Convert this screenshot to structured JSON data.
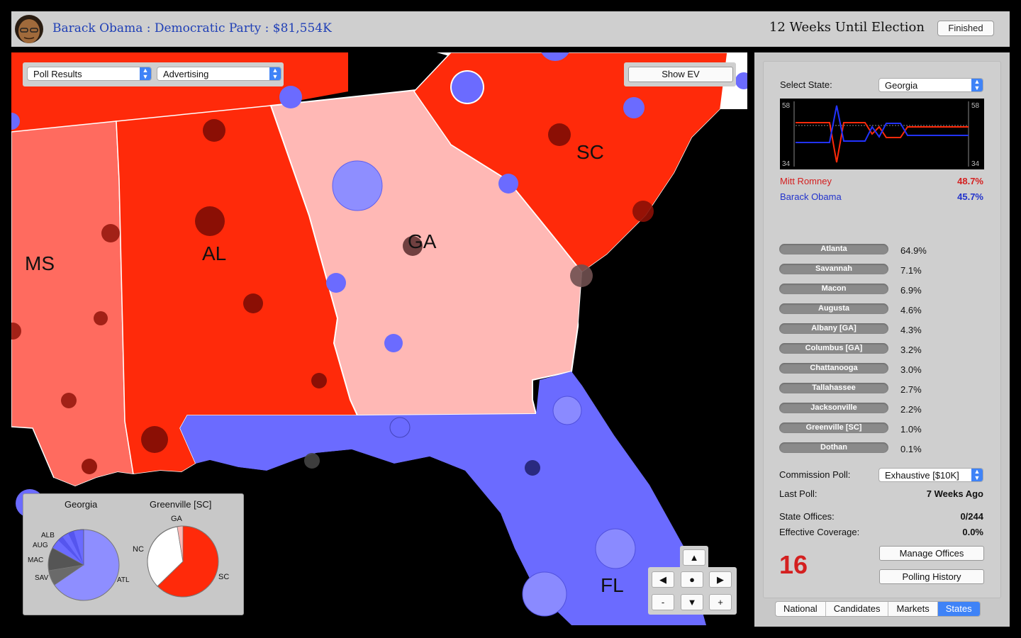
{
  "header": {
    "campaign": "Barack Obama : Democratic Party : $81,554K",
    "weeks": "12 Weeks Until Election",
    "finished_label": "Finished"
  },
  "map": {
    "dropdown_left": "Poll Results",
    "dropdown_mid": "Advertising",
    "show_ev": "Show EV",
    "states": [
      "MS",
      "AL",
      "GA",
      "SC",
      "FL"
    ]
  },
  "pies": {
    "left_title": "Georgia",
    "right_title": "Greenville [SC]",
    "left_labels": [
      "ALB",
      "AUG",
      "MAC",
      "SAV",
      "ATL"
    ],
    "right_labels": [
      "GA",
      "NC",
      "SC"
    ]
  },
  "nav": {
    "up": "▲",
    "left": "◀",
    "center": "●",
    "right": "▶",
    "minus": "-",
    "down": "▼",
    "plus": "+"
  },
  "sidebar": {
    "select_state_label": "Select State:",
    "selected_state": "Georgia",
    "graph_top": "58",
    "graph_bottom": "34",
    "candidates": [
      {
        "name": "Mitt Romney",
        "pct": "48.7%",
        "color": "#d42020"
      },
      {
        "name": "Barack Obama",
        "pct": "45.7%",
        "color": "#2233cc"
      }
    ],
    "cities": [
      {
        "name": "Atlanta",
        "pct": "64.9%"
      },
      {
        "name": "Savannah",
        "pct": "7.1%"
      },
      {
        "name": "Macon",
        "pct": "6.9%"
      },
      {
        "name": "Augusta",
        "pct": "4.6%"
      },
      {
        "name": "Albany [GA]",
        "pct": "4.3%"
      },
      {
        "name": "Columbus [GA]",
        "pct": "3.2%"
      },
      {
        "name": "Chattanooga",
        "pct": "3.0%"
      },
      {
        "name": "Tallahassee",
        "pct": "2.7%"
      },
      {
        "name": "Jacksonville",
        "pct": "2.2%"
      },
      {
        "name": "Greenville [SC]",
        "pct": "1.0%"
      },
      {
        "name": "Dothan",
        "pct": "0.1%"
      }
    ],
    "commission_label": "Commission Poll:",
    "commission_value": "Exhaustive [$10K]",
    "last_poll_label": "Last Poll:",
    "last_poll_value": "7 Weeks Ago",
    "offices_label": "State Offices:",
    "offices_value": "0/244",
    "coverage_label": "Effective Coverage:",
    "coverage_value": "0.0%",
    "ev_number": "16",
    "manage_offices": "Manage Offices",
    "polling_history": "Polling History",
    "tabs": [
      "National",
      "Candidates",
      "Markets",
      "States"
    ]
  },
  "colors": {
    "strong_red": "#ff2a0a",
    "lean_red": "#ff6b5f",
    "tilt_red": "#ffb8b5",
    "blue": "#6b6bff",
    "accent": "#3f83f7"
  }
}
